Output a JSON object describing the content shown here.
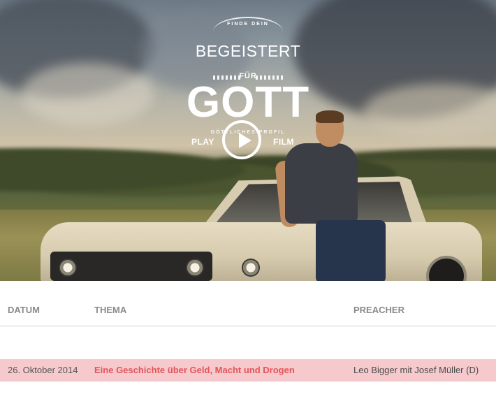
{
  "hero": {
    "logo": {
      "top_text": "FINDE DEIN",
      "line1": "BEGEISTERT",
      "line2": "FÜR",
      "line3": "GOTT",
      "sub_text": "GÖTTLICHES PROFIL"
    },
    "play_label": "PLAY",
    "film_label": "FILM",
    "play_icon": "play-icon"
  },
  "table": {
    "headers": {
      "date": "DATUM",
      "topic": "THEMA",
      "preacher": "PREACHER"
    },
    "rows": [
      {
        "date": "26. Oktober 2014",
        "topic": "Eine Geschichte über Geld, Macht und Drogen",
        "preacher": "Leo Bigger mit Josef Müller (D)"
      }
    ]
  },
  "colors": {
    "row_highlight": "#f6c9cd",
    "topic_link": "#e3545a",
    "header_text": "#8a8a8a"
  }
}
